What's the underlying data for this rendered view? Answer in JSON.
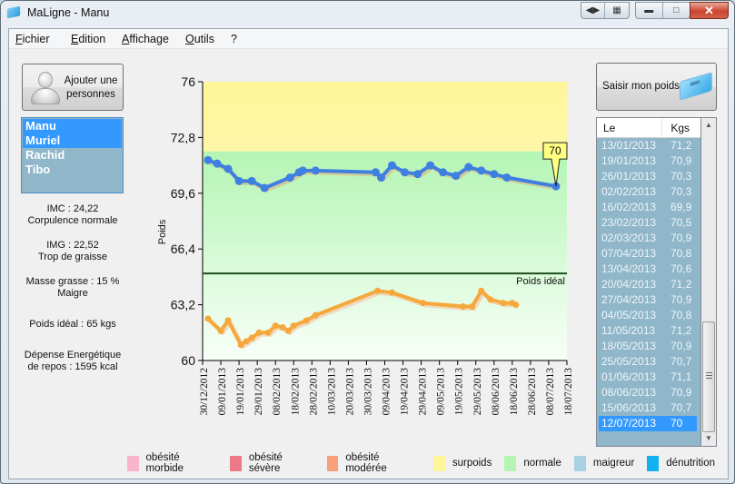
{
  "window": {
    "title": "MaLigne - Manu",
    "controls": [
      "restore-arrows",
      "pin",
      "minimize",
      "maximize",
      "close"
    ]
  },
  "menu": [
    {
      "label": "Fichier",
      "mnemonic": "F",
      "rest": "ichier"
    },
    {
      "label": "Edition",
      "mnemonic": "E",
      "rest": "dition"
    },
    {
      "label": "Affichage",
      "mnemonic": "A",
      "rest": "ffichage"
    },
    {
      "label": "Outils",
      "mnemonic": "O",
      "rest": "utils"
    },
    {
      "label": "?",
      "mnemonic": "",
      "rest": "?"
    }
  ],
  "left_panel": {
    "add_person_label_1": "Ajouter une",
    "add_person_label_2": "personnes",
    "persons": [
      {
        "name": "Manu",
        "selected": true
      },
      {
        "name": "Muriel",
        "selected": true
      },
      {
        "name": "Rachid",
        "selected": false
      },
      {
        "name": "Tibo",
        "selected": false
      }
    ],
    "stats": {
      "imc": "IMC : 24,22",
      "imc_desc": "Corpulence normale",
      "img": "IMG : 22,52",
      "img_desc": "Trop de graisse",
      "masse": "Masse grasse : 15 %",
      "masse_desc": "Maigre",
      "ideal": "Poids idéal : 65 kgs",
      "depense_1": "Dépense Energétique",
      "depense_2": "de repos : 1595 kcal"
    }
  },
  "right_panel": {
    "enter_weight_label": "Saisir mon poids",
    "table_headers": {
      "date": "Le",
      "kgs": "Kgs"
    },
    "rows": [
      {
        "date": "13/01/2013",
        "kgs": "71,2"
      },
      {
        "date": "19/01/2013",
        "kgs": "70,9"
      },
      {
        "date": "26/01/2013",
        "kgs": "70,3"
      },
      {
        "date": "02/02/2013",
        "kgs": "70,3"
      },
      {
        "date": "16/02/2013",
        "kgs": "69,9"
      },
      {
        "date": "23/02/2013",
        "kgs": "70,5"
      },
      {
        "date": "02/03/2013",
        "kgs": "70,9"
      },
      {
        "date": "07/04/2013",
        "kgs": "70,8"
      },
      {
        "date": "13/04/2013",
        "kgs": "70,6"
      },
      {
        "date": "20/04/2013",
        "kgs": "71,2"
      },
      {
        "date": "27/04/2013",
        "kgs": "70,9"
      },
      {
        "date": "04/05/2013",
        "kgs": "70,8"
      },
      {
        "date": "11/05/2013",
        "kgs": "71,2"
      },
      {
        "date": "18/05/2013",
        "kgs": "70,9"
      },
      {
        "date": "25/05/2013",
        "kgs": "70,7"
      },
      {
        "date": "01/06/2013",
        "kgs": "71,1"
      },
      {
        "date": "08/06/2013",
        "kgs": "70,9"
      },
      {
        "date": "15/06/2013",
        "kgs": "70,7"
      },
      {
        "date": "12/07/2013",
        "kgs": "70",
        "selected": true
      }
    ],
    "scroll_position": 0.85
  },
  "legend": [
    {
      "label": "obésité morbide",
      "color": "#f8b4c8"
    },
    {
      "label": "obésité sévère",
      "color": "#ec7a86"
    },
    {
      "label": "obésité modérée",
      "color": "#f7a07a"
    },
    {
      "label": "surpoids",
      "color": "#fff59a"
    },
    {
      "label": "normale",
      "color": "#b4f5b4"
    },
    {
      "label": "maigreur",
      "color": "#a8d2e4"
    },
    {
      "label": "dénutrition",
      "color": "#12b0f0"
    }
  ],
  "chart_data": {
    "type": "line",
    "title": "",
    "xlabel": "",
    "ylabel": "Poids",
    "ylim": [
      60,
      76
    ],
    "yticks": [
      "76",
      "72,8",
      "69,6",
      "66,4",
      "63,2",
      "60"
    ],
    "ytick_values": [
      76,
      72.8,
      69.6,
      66.4,
      63.2,
      60
    ],
    "xlim": [
      "30/12/2012",
      "18/07/2013"
    ],
    "xticks": [
      "30/12/2012",
      "09/01/2013",
      "19/01/2013",
      "29/01/2013",
      "08/02/2013",
      "18/02/2013",
      "28/02/2013",
      "10/03/2013",
      "20/03/2013",
      "30/03/2013",
      "09/04/2013",
      "19/04/2013",
      "29/04/2013",
      "09/05/2013",
      "19/05/2013",
      "29/05/2013",
      "08/06/2013",
      "18/06/2013",
      "28/06/2013",
      "08/07/2013",
      "18/07/2013"
    ],
    "bands": [
      {
        "label": "surpoids",
        "from": 72,
        "to": 76,
        "color": "#fff59a"
      },
      {
        "label": "normale",
        "from": 60,
        "to": 72,
        "color": "#b4f5b4"
      }
    ],
    "reference_line": {
      "label": "Poids idéal",
      "value": 65
    },
    "series": [
      {
        "name": "Manu",
        "color": "#3f7fe0",
        "x": [
          "02/01/2013",
          "07/01/2013",
          "13/01/2013",
          "19/01/2013",
          "26/01/2013",
          "02/02/2013",
          "16/02/2013",
          "21/02/2013",
          "23/02/2013",
          "02/03/2013",
          "04/04/2013",
          "07/04/2013",
          "13/04/2013",
          "20/04/2013",
          "27/04/2013",
          "04/05/2013",
          "11/05/2013",
          "18/05/2013",
          "25/05/2013",
          "01/06/2013",
          "08/06/2013",
          "15/06/2013",
          "12/07/2013"
        ],
        "y": [
          71.5,
          71.3,
          71.0,
          70.3,
          70.3,
          69.9,
          70.5,
          70.8,
          70.9,
          70.9,
          70.8,
          70.5,
          71.2,
          70.8,
          70.7,
          71.2,
          70.8,
          70.6,
          71.1,
          70.9,
          70.7,
          70.5,
          70.0
        ],
        "annotation": {
          "x": "12/07/2013",
          "text": "70"
        }
      },
      {
        "name": "Muriel",
        "color": "#f5a83c",
        "x": [
          "02/01/2013",
          "09/01/2013",
          "13/01/2013",
          "20/01/2013",
          "23/01/2013",
          "26/01/2013",
          "30/01/2013",
          "04/02/2013",
          "08/02/2013",
          "12/02/2013",
          "15/02/2013",
          "18/02/2013",
          "25/02/2013",
          "02/03/2013",
          "05/04/2013",
          "13/04/2013",
          "30/04/2013",
          "22/05/2013",
          "27/05/2013",
          "01/06/2013",
          "06/06/2013",
          "13/06/2013",
          "18/06/2013",
          "20/06/2013"
        ],
        "y": [
          62.4,
          61.7,
          62.3,
          60.9,
          61.1,
          61.3,
          61.6,
          61.6,
          62.0,
          61.9,
          61.7,
          62.0,
          62.3,
          62.6,
          64.0,
          63.9,
          63.3,
          63.1,
          63.1,
          64.0,
          63.5,
          63.3,
          63.3,
          63.2
        ]
      }
    ]
  }
}
